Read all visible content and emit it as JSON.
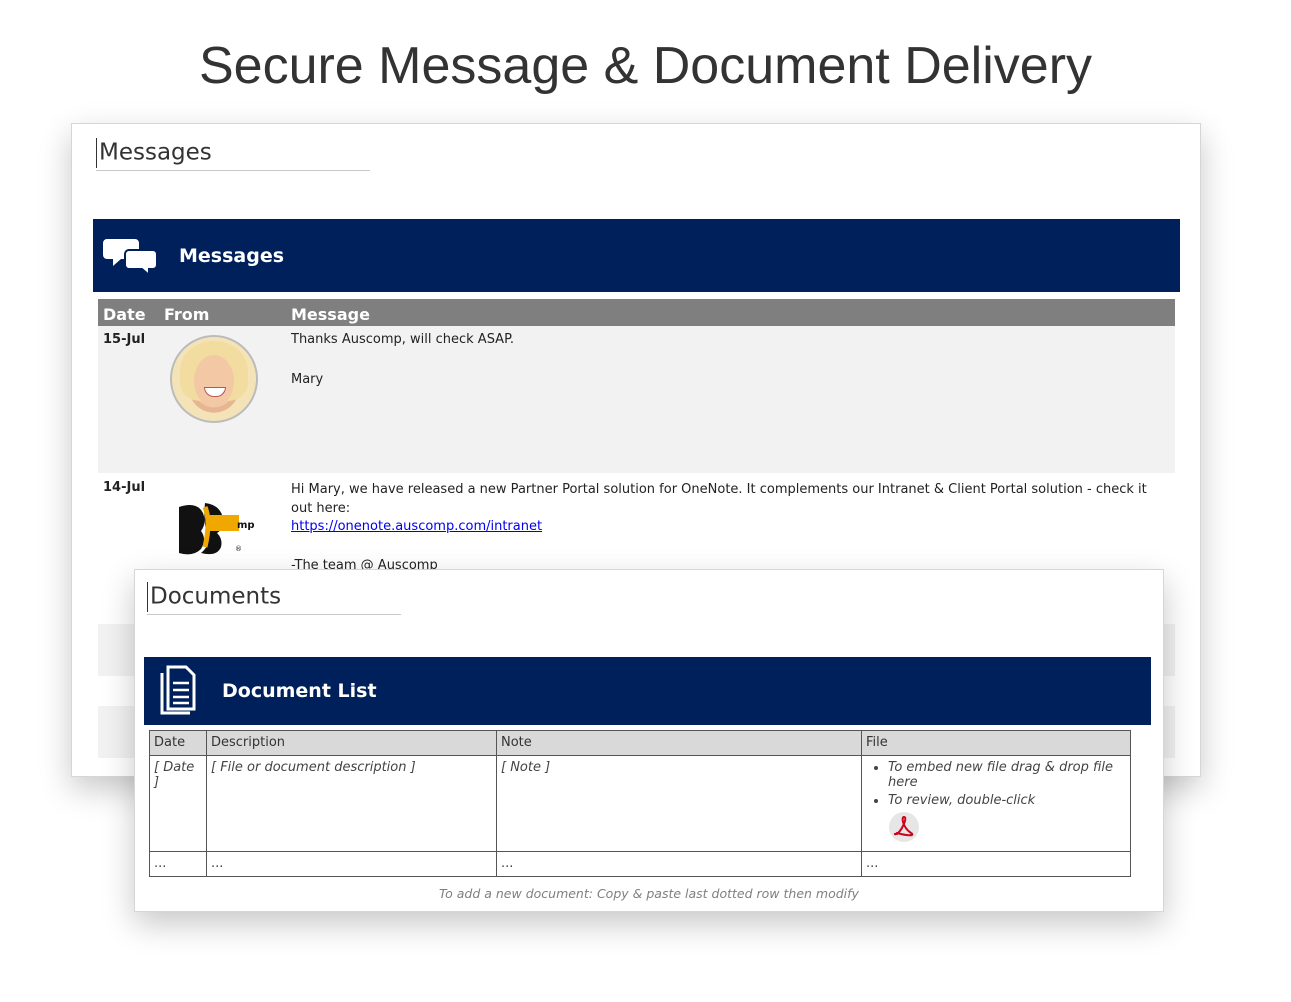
{
  "main_title": "Secure Message & Document Delivery",
  "messages_page": {
    "title": "Messages",
    "banner_title": "Messages",
    "columns": [
      "Date",
      "From",
      "Message"
    ],
    "rows": [
      {
        "date": "15-Jul",
        "from": "avatar-photo",
        "lines": [
          "Thanks Auscomp, will check ASAP.",
          "Mary"
        ]
      },
      {
        "date": "14-Jul",
        "from": "auscomp-logo",
        "line1": "Hi Mary, we have released a new Partner Portal solution for OneNote. It complements our Intranet & Client Portal solution - check it out here:",
        "link": "https://onenote.auscomp.com/intranet",
        "signoff": "-The team @ Auscomp"
      }
    ],
    "logo_text": "auscomp"
  },
  "documents_page": {
    "title": "Documents",
    "banner_title": "Document List",
    "columns": [
      "Date",
      "Description",
      "Note",
      "File"
    ],
    "row1": {
      "date": "[ Date ]",
      "description": "[ File or document description ]",
      "note": "[ Note ]",
      "file_bullets": [
        "To embed new file drag & drop file here",
        "To review, double-click"
      ]
    },
    "row2": {
      "date": "...",
      "description": "...",
      "note": "...",
      "file": "..."
    },
    "footnote": "To add a new document: Copy & paste last dotted row then modify"
  },
  "colors": {
    "banner": "#00205b",
    "header_gray": "#7f7f7f",
    "row_bg": "#f2f2f2",
    "pdf_red": "#d0021b"
  }
}
